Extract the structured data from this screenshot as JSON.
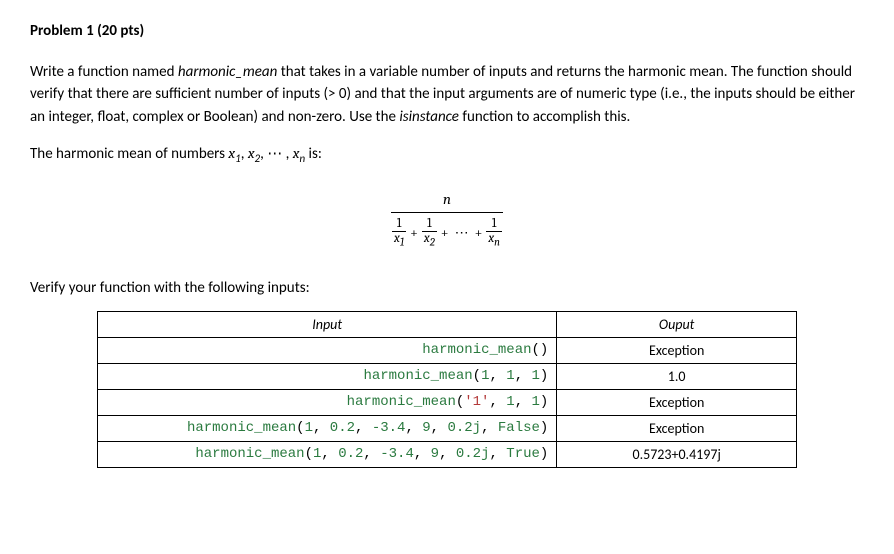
{
  "title": "Problem 1 (20 pts)",
  "para1_a": "Write a function named ",
  "para1_fn": "harmonic_mean",
  "para1_b": " that takes in a variable number of inputs and returns the harmonic mean. The function should verify that there are sufficient number of inputs (> 0) and that the input arguments are of numeric type (i.e., the inputs should be either an integer, float, complex or Boolean) and non-zero. Use the ",
  "para1_is": "isinstance",
  "para1_c": " function to accomplish this.",
  "formula_intro_a": "The harmonic mean of numbers ",
  "formula_intro_b": " is:",
  "vars": {
    "x1": "x",
    "s1": "1",
    "x2": "x",
    "s2": "2",
    "xn": "x",
    "sn": "n"
  },
  "formula": {
    "numer": "n",
    "t1": "1",
    "b1": "x",
    "bs1": "1",
    "t2": "1",
    "b2": "x",
    "bs2": "2",
    "tn": "1",
    "bn": "x",
    "bsn": "n",
    "plus": "+",
    "dots": "⋯"
  },
  "verify": "Verify your function with the following inputs:",
  "table": {
    "head_input": "Input",
    "head_output": "Ouput",
    "rows": [
      {
        "input": "harmonic_mean()",
        "output": "Exception"
      },
      {
        "input": "harmonic_mean(1, 1, 1)",
        "output": "1.0"
      },
      {
        "input": "harmonic_mean('1', 1, 1)",
        "output": "Exception"
      },
      {
        "input": "harmonic_mean(1, 0.2, -3.4, 9, 0.2j, False)",
        "output": "Exception"
      },
      {
        "input": "harmonic_mean(1, 0.2, -3.4, 9, 0.2j, True)",
        "output": "0.5723+0.4197j"
      }
    ]
  },
  "code_rows": [
    [
      {
        "t": "harmonic_mean",
        "c": "fn"
      },
      {
        "t": "()",
        "c": "p"
      }
    ],
    [
      {
        "t": "harmonic_mean",
        "c": "fn"
      },
      {
        "t": "(",
        "c": "p"
      },
      {
        "t": "1",
        "c": "num"
      },
      {
        "t": ", ",
        "c": "p"
      },
      {
        "t": "1",
        "c": "num"
      },
      {
        "t": ", ",
        "c": "p"
      },
      {
        "t": "1",
        "c": "num"
      },
      {
        "t": ")",
        "c": "p"
      }
    ],
    [
      {
        "t": "harmonic_mean",
        "c": "fn"
      },
      {
        "t": "(",
        "c": "p"
      },
      {
        "t": "'1'",
        "c": "str"
      },
      {
        "t": ", ",
        "c": "p"
      },
      {
        "t": "1",
        "c": "num"
      },
      {
        "t": ", ",
        "c": "p"
      },
      {
        "t": "1",
        "c": "num"
      },
      {
        "t": ")",
        "c": "p"
      }
    ],
    [
      {
        "t": "harmonic_mean",
        "c": "fn"
      },
      {
        "t": "(",
        "c": "p"
      },
      {
        "t": "1",
        "c": "num"
      },
      {
        "t": ", ",
        "c": "p"
      },
      {
        "t": "0.2",
        "c": "num"
      },
      {
        "t": ", ",
        "c": "p"
      },
      {
        "t": "-3.4",
        "c": "num"
      },
      {
        "t": ", ",
        "c": "p"
      },
      {
        "t": "9",
        "c": "num"
      },
      {
        "t": ", ",
        "c": "p"
      },
      {
        "t": "0.2j",
        "c": "num"
      },
      {
        "t": ", ",
        "c": "p"
      },
      {
        "t": "False",
        "c": "kw"
      },
      {
        "t": ")",
        "c": "p"
      }
    ],
    [
      {
        "t": "harmonic_mean",
        "c": "fn"
      },
      {
        "t": "(",
        "c": "p"
      },
      {
        "t": "1",
        "c": "num"
      },
      {
        "t": ", ",
        "c": "p"
      },
      {
        "t": "0.2",
        "c": "num"
      },
      {
        "t": ", ",
        "c": "p"
      },
      {
        "t": "-3.4",
        "c": "num"
      },
      {
        "t": ", ",
        "c": "p"
      },
      {
        "t": "9",
        "c": "num"
      },
      {
        "t": ", ",
        "c": "p"
      },
      {
        "t": "0.2j",
        "c": "num"
      },
      {
        "t": ", ",
        "c": "p"
      },
      {
        "t": "True",
        "c": "kwT"
      },
      {
        "t": ")",
        "c": "p"
      }
    ]
  ]
}
